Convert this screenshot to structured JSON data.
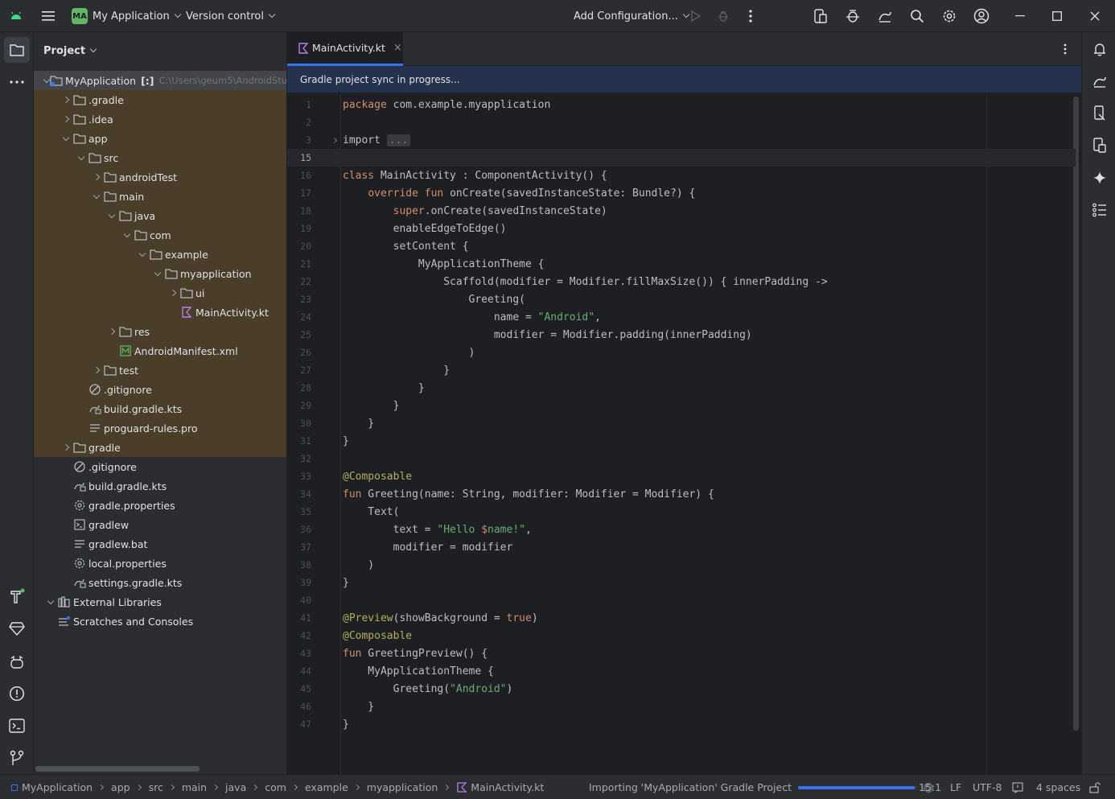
{
  "titlebar": {
    "project_badge": "MA",
    "project_name": "My Application",
    "vcs": "Version control",
    "run_config": "Add Configuration..."
  },
  "project_panel": {
    "title": "Project",
    "root_name": "MyApplication",
    "root_tag": "[:]",
    "root_path": "C:\\Users\\geum5\\AndroidStu",
    "items": [
      {
        "label": ".gradle",
        "icon": "folder-icon"
      },
      {
        "label": ".idea",
        "icon": "folder-icon"
      },
      {
        "label": "app",
        "icon": "folder-icon"
      },
      {
        "label": "src",
        "icon": "folder-icon"
      },
      {
        "label": "androidTest",
        "icon": "folder-icon"
      },
      {
        "label": "main",
        "icon": "folder-icon"
      },
      {
        "label": "java",
        "icon": "folder-icon"
      },
      {
        "label": "com",
        "icon": "folder-icon"
      },
      {
        "label": "example",
        "icon": "folder-icon"
      },
      {
        "label": "myapplication",
        "icon": "folder-icon"
      },
      {
        "label": "ui",
        "icon": "folder-icon"
      },
      {
        "label": "MainActivity.kt",
        "icon": "kotlin-file-icon"
      },
      {
        "label": "res",
        "icon": "folder-icon"
      },
      {
        "label": "AndroidManifest.xml",
        "icon": "manifest-icon"
      },
      {
        "label": "test",
        "icon": "folder-icon"
      },
      {
        "label": ".gitignore",
        "icon": "ignore-file-icon"
      },
      {
        "label": "build.gradle.kts",
        "icon": "gradle-file-icon"
      },
      {
        "label": "proguard-rules.pro",
        "icon": "text-file-icon"
      },
      {
        "label": "gradle",
        "icon": "folder-icon"
      },
      {
        "label": ".gitignore",
        "icon": "ignore-file-icon"
      },
      {
        "label": "build.gradle.kts",
        "icon": "gradle-file-icon"
      },
      {
        "label": "gradle.properties",
        "icon": "settings-file-icon"
      },
      {
        "label": "gradlew",
        "icon": "terminal-file-icon"
      },
      {
        "label": "gradlew.bat",
        "icon": "text-file-icon"
      },
      {
        "label": "local.properties",
        "icon": "settings-file-icon"
      },
      {
        "label": "settings.gradle.kts",
        "icon": "gradle-file-icon"
      },
      {
        "label": "External Libraries",
        "icon": "library-icon"
      },
      {
        "label": "Scratches and Consoles",
        "icon": "scratches-icon"
      }
    ]
  },
  "editor": {
    "tab_label": "MainActivity.kt",
    "tab_close": "×",
    "notice": "Gradle project sync in progress...",
    "lines": [
      {
        "n": "1",
        "t": "package com.example.myapplication"
      },
      {
        "n": "2",
        "t": ""
      },
      {
        "n": "3",
        "t": "import ..."
      },
      {
        "n": "15",
        "t": ""
      },
      {
        "n": "16",
        "t": "class MainActivity : ComponentActivity() {"
      },
      {
        "n": "17",
        "t": "    override fun onCreate(savedInstanceState: Bundle?) {"
      },
      {
        "n": "18",
        "t": "        super.onCreate(savedInstanceState)"
      },
      {
        "n": "19",
        "t": "        enableEdgeToEdge()"
      },
      {
        "n": "20",
        "t": "        setContent {"
      },
      {
        "n": "21",
        "t": "            MyApplicationTheme {"
      },
      {
        "n": "22",
        "t": "                Scaffold(modifier = Modifier.fillMaxSize()) { innerPadding ->"
      },
      {
        "n": "23",
        "t": "                    Greeting("
      },
      {
        "n": "24",
        "t": "                        name = \"Android\","
      },
      {
        "n": "25",
        "t": "                        modifier = Modifier.padding(innerPadding)"
      },
      {
        "n": "26",
        "t": "                    )"
      },
      {
        "n": "27",
        "t": "                }"
      },
      {
        "n": "28",
        "t": "            }"
      },
      {
        "n": "29",
        "t": "        }"
      },
      {
        "n": "30",
        "t": "    }"
      },
      {
        "n": "31",
        "t": "}"
      },
      {
        "n": "32",
        "t": ""
      },
      {
        "n": "33",
        "t": "@Composable"
      },
      {
        "n": "34",
        "t": "fun Greeting(name: String, modifier: Modifier = Modifier) {"
      },
      {
        "n": "35",
        "t": "    Text("
      },
      {
        "n": "36",
        "t": "        text = \"Hello $name!\","
      },
      {
        "n": "37",
        "t": "        modifier = modifier"
      },
      {
        "n": "38",
        "t": "    )"
      },
      {
        "n": "39",
        "t": "}"
      },
      {
        "n": "40",
        "t": ""
      },
      {
        "n": "41",
        "t": "@Preview(showBackground = true)"
      },
      {
        "n": "42",
        "t": "@Composable"
      },
      {
        "n": "43",
        "t": "fun GreetingPreview() {"
      },
      {
        "n": "44",
        "t": "    MyApplicationTheme {"
      },
      {
        "n": "45",
        "t": "        Greeting(\"Android\")"
      },
      {
        "n": "46",
        "t": "    }"
      },
      {
        "n": "47",
        "t": "}"
      }
    ]
  },
  "statusbar": {
    "breadcrumbs": [
      "MyApplication",
      "app",
      "src",
      "main",
      "java",
      "com",
      "example",
      "myapplication",
      "MainActivity.kt"
    ],
    "task": "Importing 'MyApplication' Gradle Project",
    "progress": 0.98,
    "caret": "15:1",
    "line_sep": "LF",
    "encoding": "UTF-8",
    "indent": "4 spaces"
  },
  "colors": {
    "accent": "#3574f0",
    "highlight_tree": "#4a3d2a",
    "badge": "#5fb865"
  }
}
